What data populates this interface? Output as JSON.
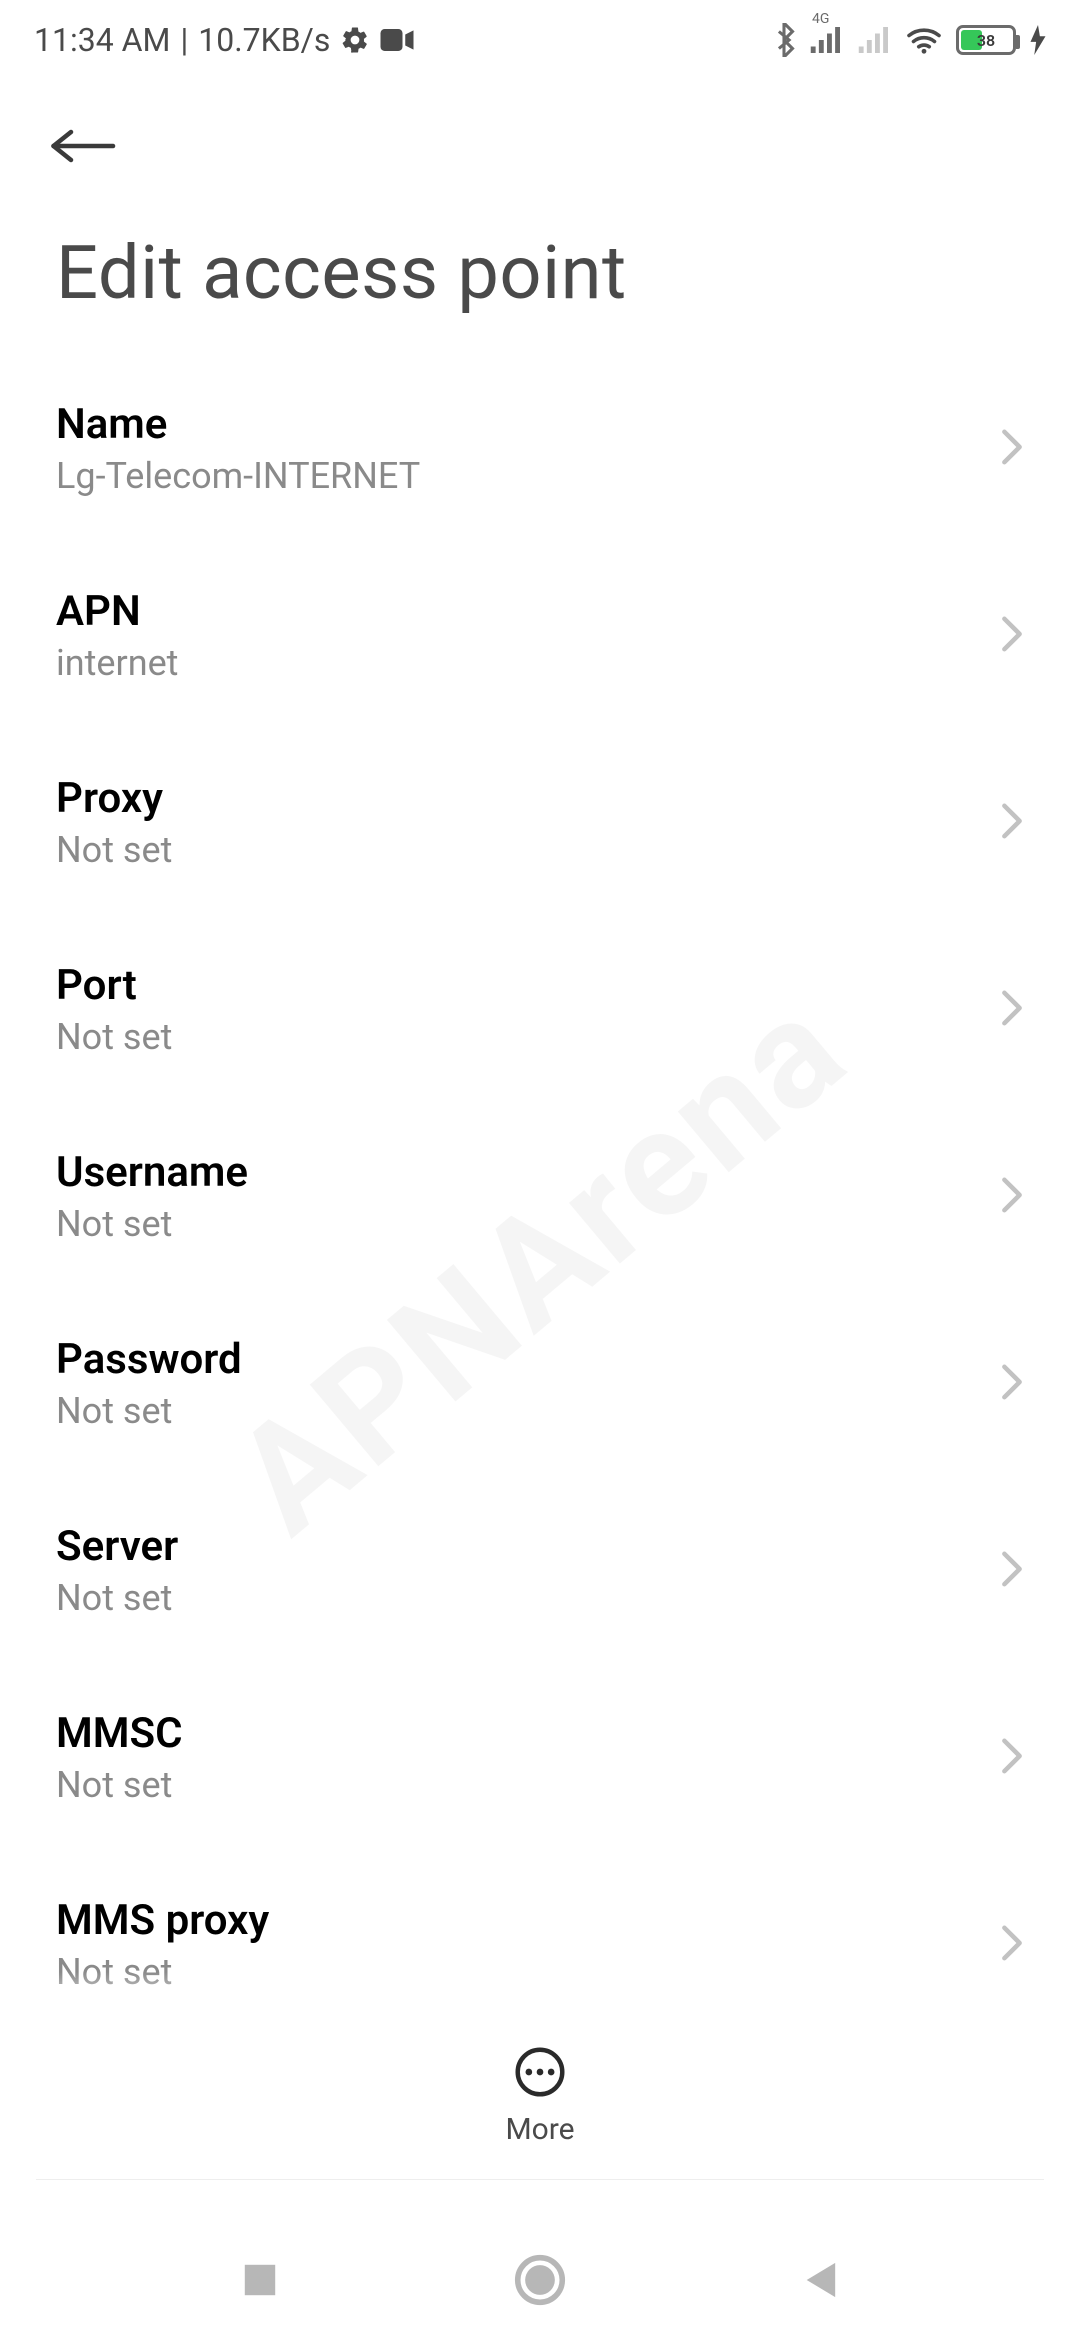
{
  "status": {
    "time": "11:34 AM",
    "speed": "10.7KB/s",
    "battery_pct": "38"
  },
  "page": {
    "title": "Edit access point"
  },
  "rows": [
    {
      "label": "Name",
      "value": "Lg-Telecom-INTERNET"
    },
    {
      "label": "APN",
      "value": "internet"
    },
    {
      "label": "Proxy",
      "value": "Not set"
    },
    {
      "label": "Port",
      "value": "Not set"
    },
    {
      "label": "Username",
      "value": "Not set"
    },
    {
      "label": "Password",
      "value": "Not set"
    },
    {
      "label": "Server",
      "value": "Not set"
    },
    {
      "label": "MMSC",
      "value": "Not set"
    },
    {
      "label": "MMS proxy",
      "value": "Not set"
    }
  ],
  "bottom": {
    "more": "More"
  },
  "watermark": "APNArena"
}
